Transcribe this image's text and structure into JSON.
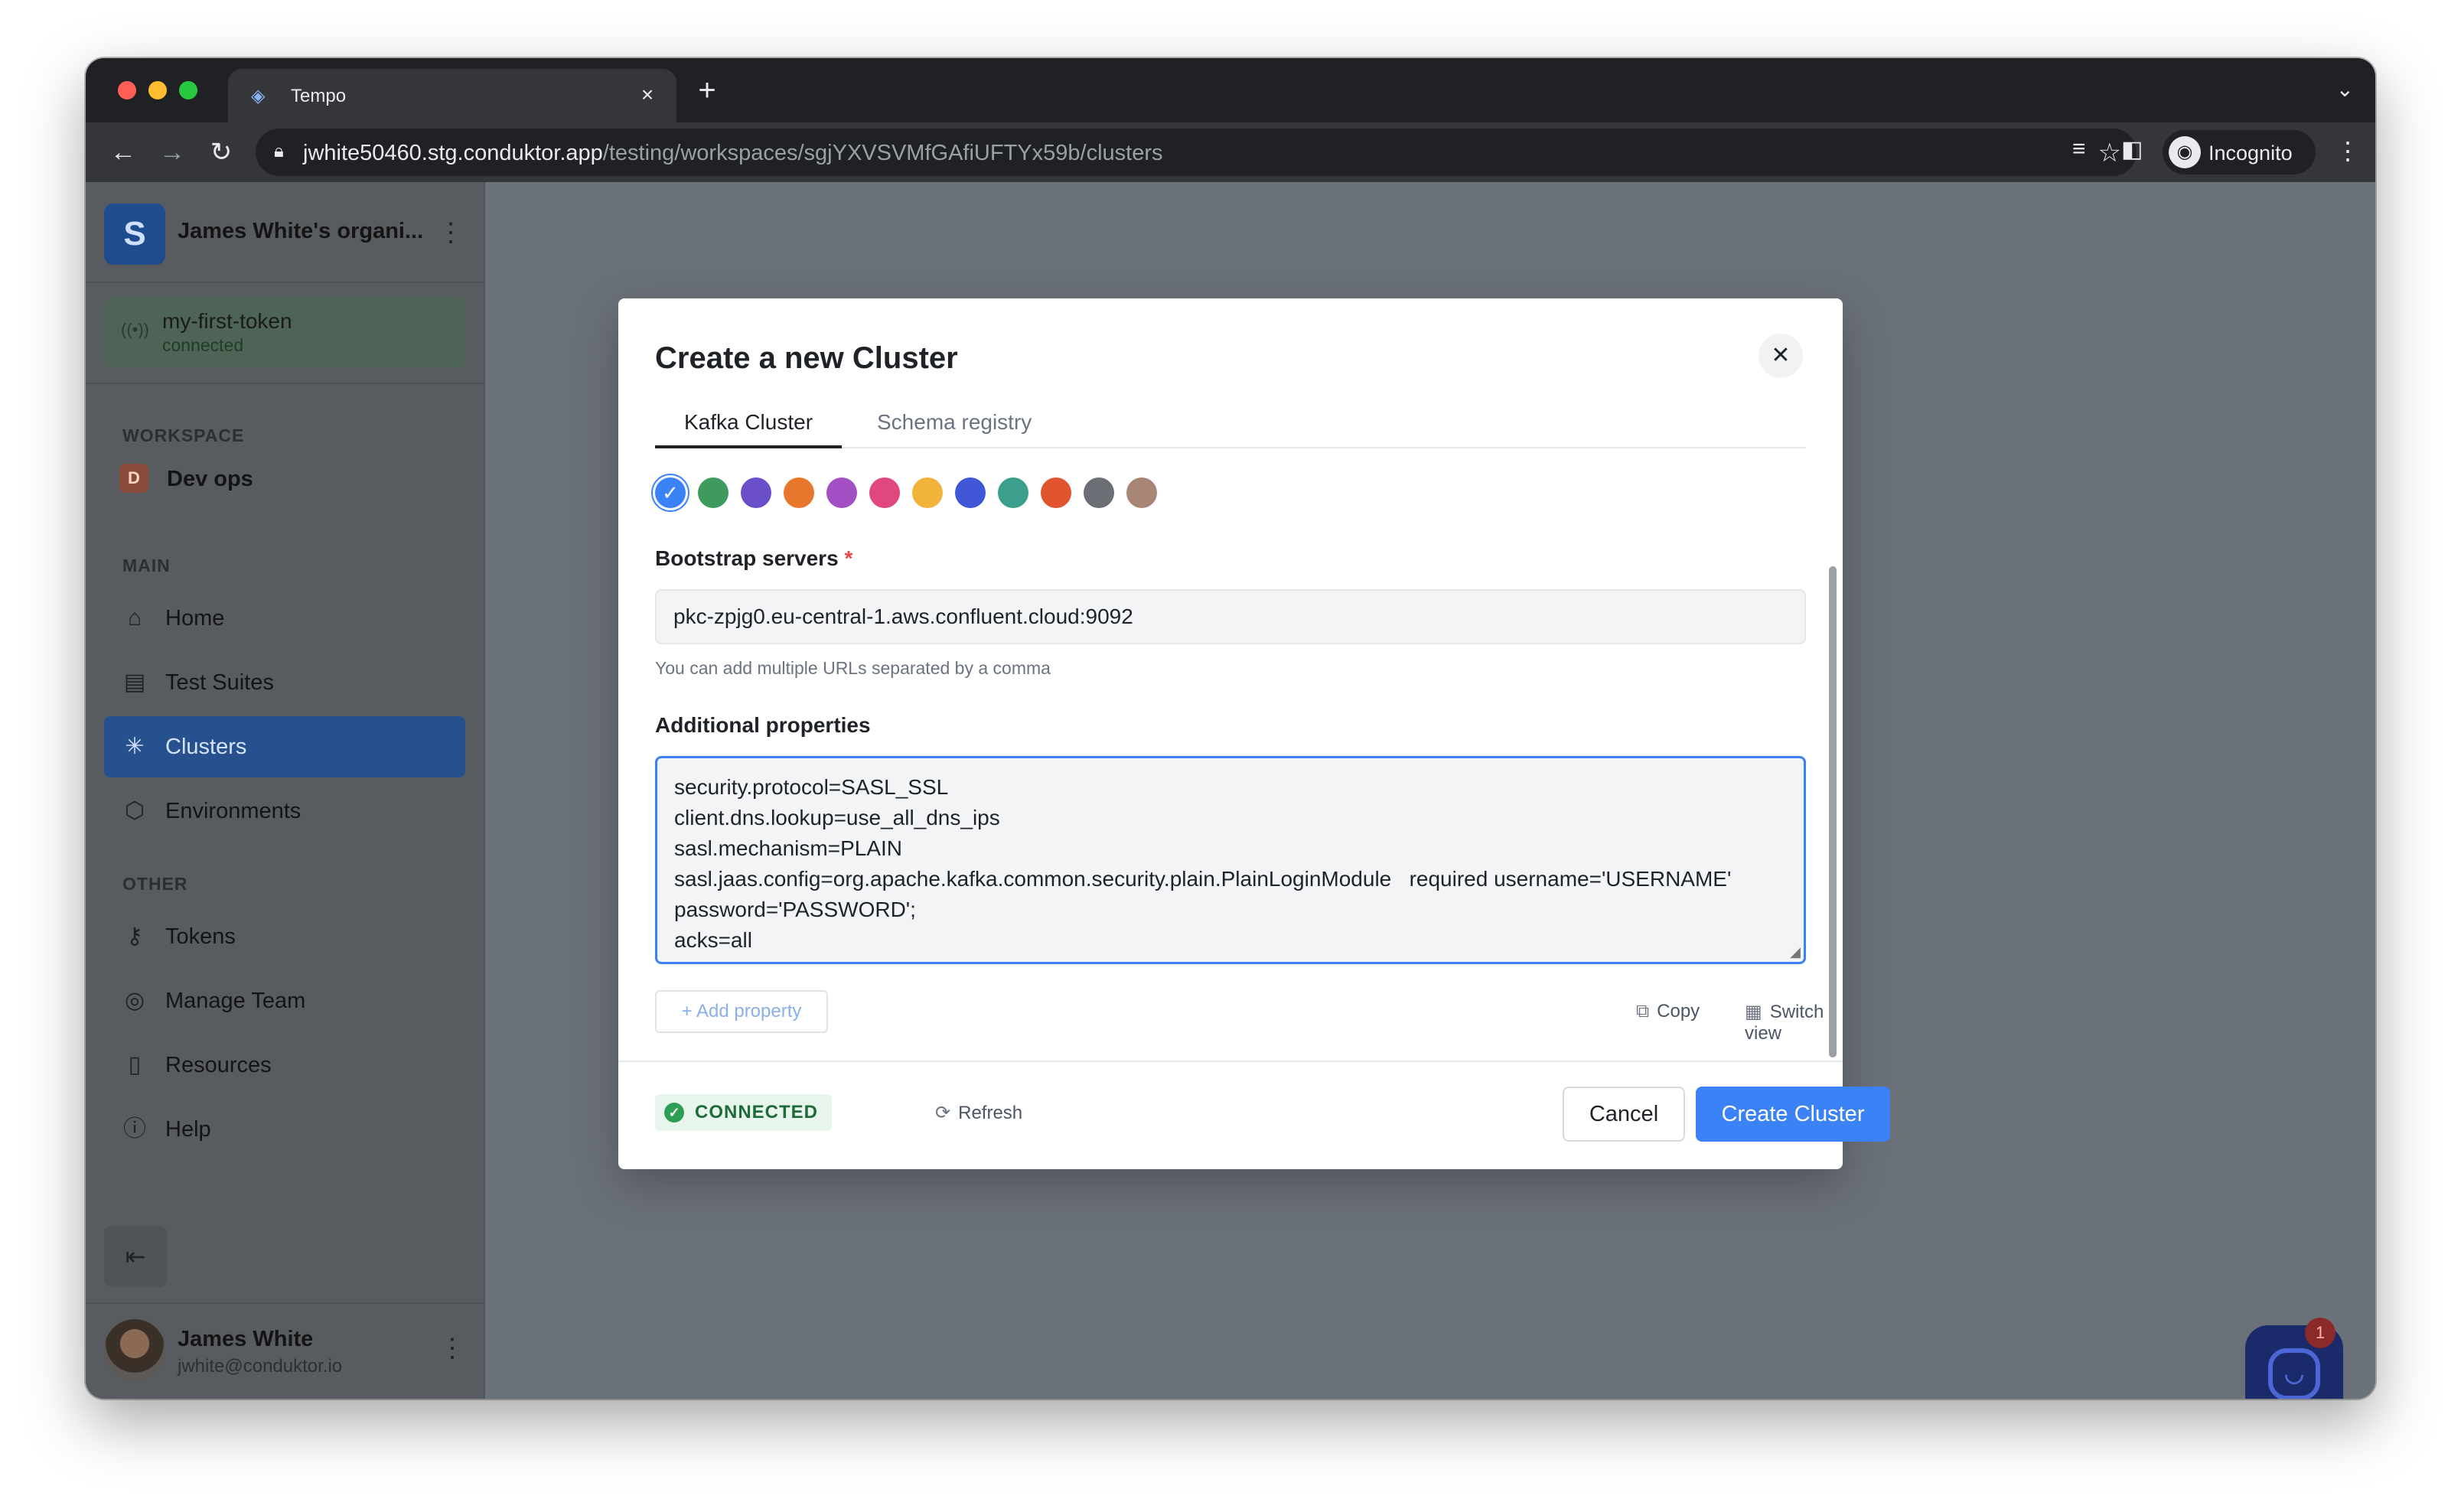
{
  "browser": {
    "tab_title": "Tempo",
    "url_host": "jwhite50460.stg.conduktor.app",
    "url_path": "/testing/workspaces/sgjYXVSVMfGAfiUFTYx59b/clusters",
    "profile_label": "Incognito"
  },
  "sidebar": {
    "org_name": "James White's organi...",
    "token": {
      "name": "my-first-token",
      "status": "connected"
    },
    "workspace_section": "WORKSPACE",
    "workspace": {
      "badge": "D",
      "label": "Dev ops"
    },
    "main_section": "MAIN",
    "main_items": [
      {
        "label": "Home",
        "icon": "home-icon"
      },
      {
        "label": "Test Suites",
        "icon": "document-icon"
      },
      {
        "label": "Clusters",
        "icon": "asterisk-icon",
        "active": true
      },
      {
        "label": "Environments",
        "icon": "cube-icon"
      }
    ],
    "other_section": "OTHER",
    "other_items": [
      {
        "label": "Tokens",
        "icon": "key-icon"
      },
      {
        "label": "Manage Team",
        "icon": "user-circle-icon"
      },
      {
        "label": "Resources",
        "icon": "book-icon"
      },
      {
        "label": "Help",
        "icon": "info-icon"
      }
    ],
    "user": {
      "name": "James White",
      "email": "jwhite@conduktor.io"
    }
  },
  "modal": {
    "title": "Create a new Cluster",
    "tabs": [
      {
        "label": "Kafka Cluster",
        "active": true
      },
      {
        "label": "Schema registry",
        "active": false
      }
    ],
    "colors": [
      "#3b82f6",
      "#3f9a5e",
      "#6a4fc9",
      "#e8772e",
      "#a24fc4",
      "#e0477f",
      "#f1b33a",
      "#3f56d6",
      "#3c9e8c",
      "#e0542f",
      "#6b6e74",
      "#a88675"
    ],
    "selected_color_index": 0,
    "bootstrap_label": "Bootstrap servers",
    "required_mark": "*",
    "bootstrap_value": "pkc-zpjg0.eu-central-1.aws.confluent.cloud:9092",
    "bootstrap_hint": "You can add multiple URLs separated by a comma",
    "additional_label": "Additional properties",
    "properties_lines": [
      "security.protocol=SASL_SSL",
      "client.dns.lookup=use_all_dns_ips",
      "sasl.mechanism=PLAIN",
      "sasl.jaas.config=org.apache.kafka.common.security.plain.PlainLoginModule   required username='USERNAME'",
      "password='PASSWORD';",
      "acks=all"
    ],
    "add_property": "+ Add property",
    "copy": "Copy",
    "switch_view": "Switch view",
    "status": "CONNECTED",
    "refresh": "Refresh",
    "cancel": "Cancel",
    "create": "Create Cluster"
  },
  "chat": {
    "badge_count": "1"
  }
}
